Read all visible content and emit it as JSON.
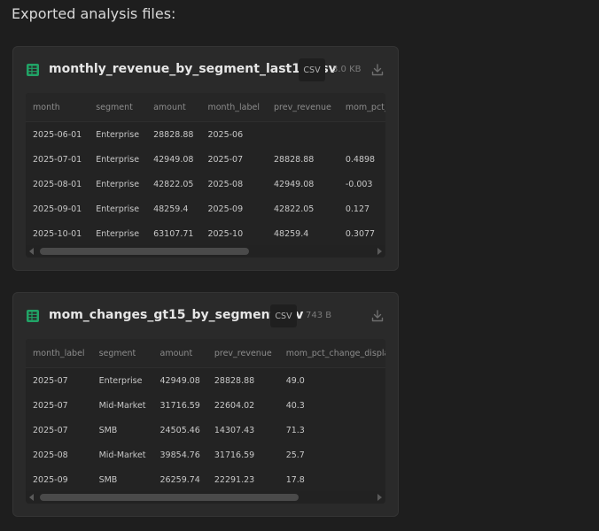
{
  "heading": "Exported analysis files:",
  "files": [
    {
      "name": "monthly_revenue_by_segment_last12.csv",
      "type": "CSV",
      "size": "3.0 KB",
      "icon": "spreadsheet-icon",
      "columns": [
        "month",
        "segment",
        "amount",
        "month_label",
        "prev_revenue",
        "mom_pct_c"
      ],
      "rows": [
        [
          "2025-06-01",
          "Enterprise",
          "28828.88",
          "2025-06",
          "",
          ""
        ],
        [
          "2025-07-01",
          "Enterprise",
          "42949.08",
          "2025-07",
          "28828.88",
          "0.4898"
        ],
        [
          "2025-08-01",
          "Enterprise",
          "42822.05",
          "2025-08",
          "42949.08",
          "-0.003"
        ],
        [
          "2025-09-01",
          "Enterprise",
          "48259.4",
          "2025-09",
          "42822.05",
          "0.127"
        ],
        [
          "2025-10-01",
          "Enterprise",
          "63107.71",
          "2025-10",
          "48259.4",
          "0.3077"
        ]
      ]
    },
    {
      "name": "mom_changes_gt15_by_segment.csv",
      "type": "CSV",
      "size": "743 B",
      "icon": "spreadsheet-icon",
      "columns": [
        "month_label",
        "segment",
        "amount",
        "prev_revenue",
        "mom_pct_change_displa"
      ],
      "rows": [
        [
          "2025-07",
          "Enterprise",
          "42949.08",
          "28828.88",
          "49.0"
        ],
        [
          "2025-07",
          "Mid-Market",
          "31716.59",
          "22604.02",
          "40.3"
        ],
        [
          "2025-07",
          "SMB",
          "24505.46",
          "14307.43",
          "71.3"
        ],
        [
          "2025-08",
          "Mid-Market",
          "39854.76",
          "31716.59",
          "25.7"
        ],
        [
          "2025-09",
          "SMB",
          "26259.74",
          "22291.23",
          "17.8"
        ]
      ]
    }
  ],
  "colors": {
    "background": "#1e1e1e",
    "card": "#2a2a2a",
    "spreadsheet_icon": "#21a366"
  }
}
